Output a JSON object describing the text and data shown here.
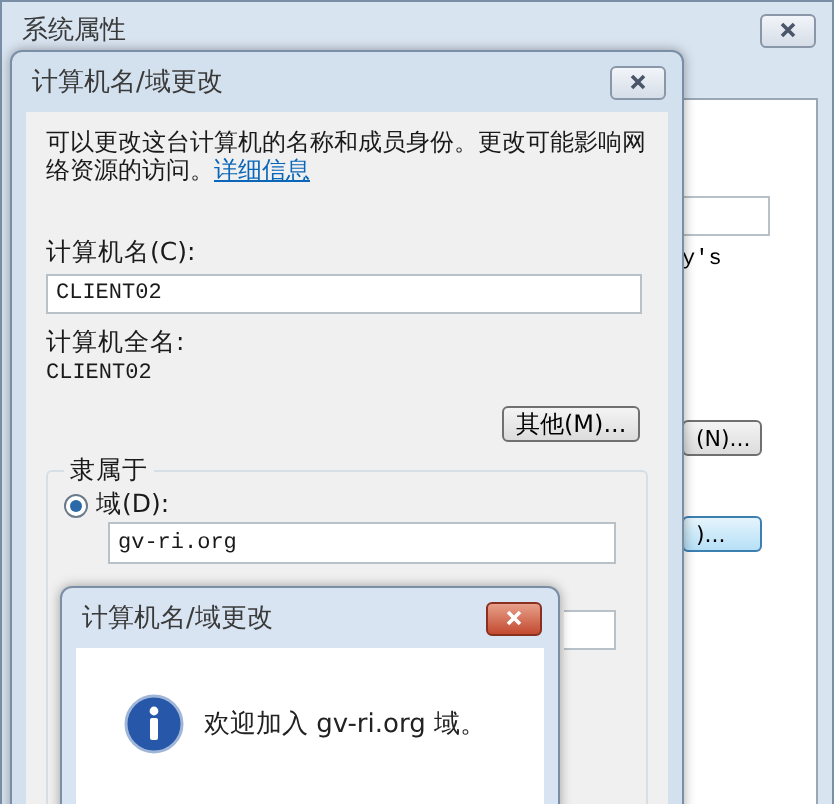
{
  "background_window": {
    "title": "系统属性",
    "text_fragment": "y's",
    "button_fragments": [
      {
        "label": "(N)...",
        "focused": false
      },
      {
        "label": ")...",
        "focused": true
      }
    ]
  },
  "name_dialog": {
    "title": "计算机名/域更改",
    "description": "可以更改这台计算机的名称和成员身份。更改可能影响网络资源的访问。",
    "details_link": "详细信息",
    "computer_name_label": "计算机名(C):",
    "computer_name_value": "CLIENT02",
    "full_name_label": "计算机全名:",
    "full_name_value": "CLIENT02",
    "other_button": "其他(M)...",
    "member_of": {
      "label": "隶属于",
      "options": [
        {
          "label": "域(D):",
          "selected": true,
          "value": "gv-ri.org"
        }
      ]
    }
  },
  "message_dialog": {
    "title": "计算机名/域更改",
    "message": "欢迎加入 gv-ri.org 域。"
  }
}
